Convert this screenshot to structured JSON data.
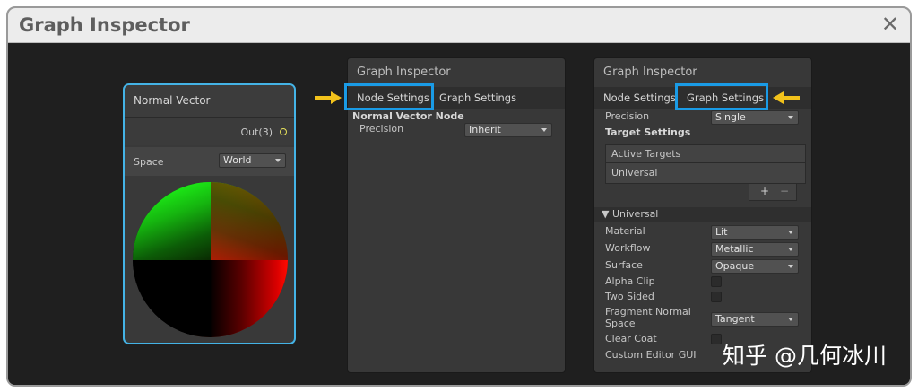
{
  "window": {
    "title": "Graph Inspector",
    "close_glyph": "✕"
  },
  "node": {
    "title": "Normal Vector",
    "output_label": "Out(3)",
    "space_label": "Space",
    "space_value": "World"
  },
  "panel_left": {
    "title": "Graph Inspector",
    "tabs": [
      "Node Settings",
      "Graph Settings"
    ],
    "active_tab_index": 0,
    "section_title": "Normal Vector Node",
    "precision_label": "Precision",
    "precision_value": "Inherit"
  },
  "panel_right": {
    "title": "Graph Inspector",
    "tabs": [
      "Node Settings",
      "Graph Settings"
    ],
    "active_tab_index": 1,
    "precision_label": "Precision",
    "precision_value": "Single",
    "target_settings_label": "Target Settings",
    "active_targets_label": "Active Targets",
    "active_targets": [
      "Universal"
    ],
    "add_glyph": "+",
    "remove_glyph": "−",
    "section_label": "▼ Universal",
    "fields": {
      "material": {
        "label": "Material",
        "value": "Lit"
      },
      "workflow": {
        "label": "Workflow",
        "value": "Metallic"
      },
      "surface": {
        "label": "Surface",
        "value": "Opaque"
      },
      "alpha_clip": {
        "label": "Alpha Clip"
      },
      "two_sided": {
        "label": "Two Sided"
      },
      "fragment_normal_space": {
        "label_line1": "Fragment Normal",
        "label_line2": "Space",
        "value": "Tangent"
      },
      "clear_coat": {
        "label": "Clear Coat"
      },
      "custom_editor_gui": {
        "label": "Custom Editor GUI"
      }
    }
  },
  "watermark": "知乎 @几何冰川",
  "colors": {
    "highlight": "#1a9be6",
    "arrow": "#f2c21b",
    "node_border": "#44b3e6",
    "port": "#e8e25c"
  }
}
